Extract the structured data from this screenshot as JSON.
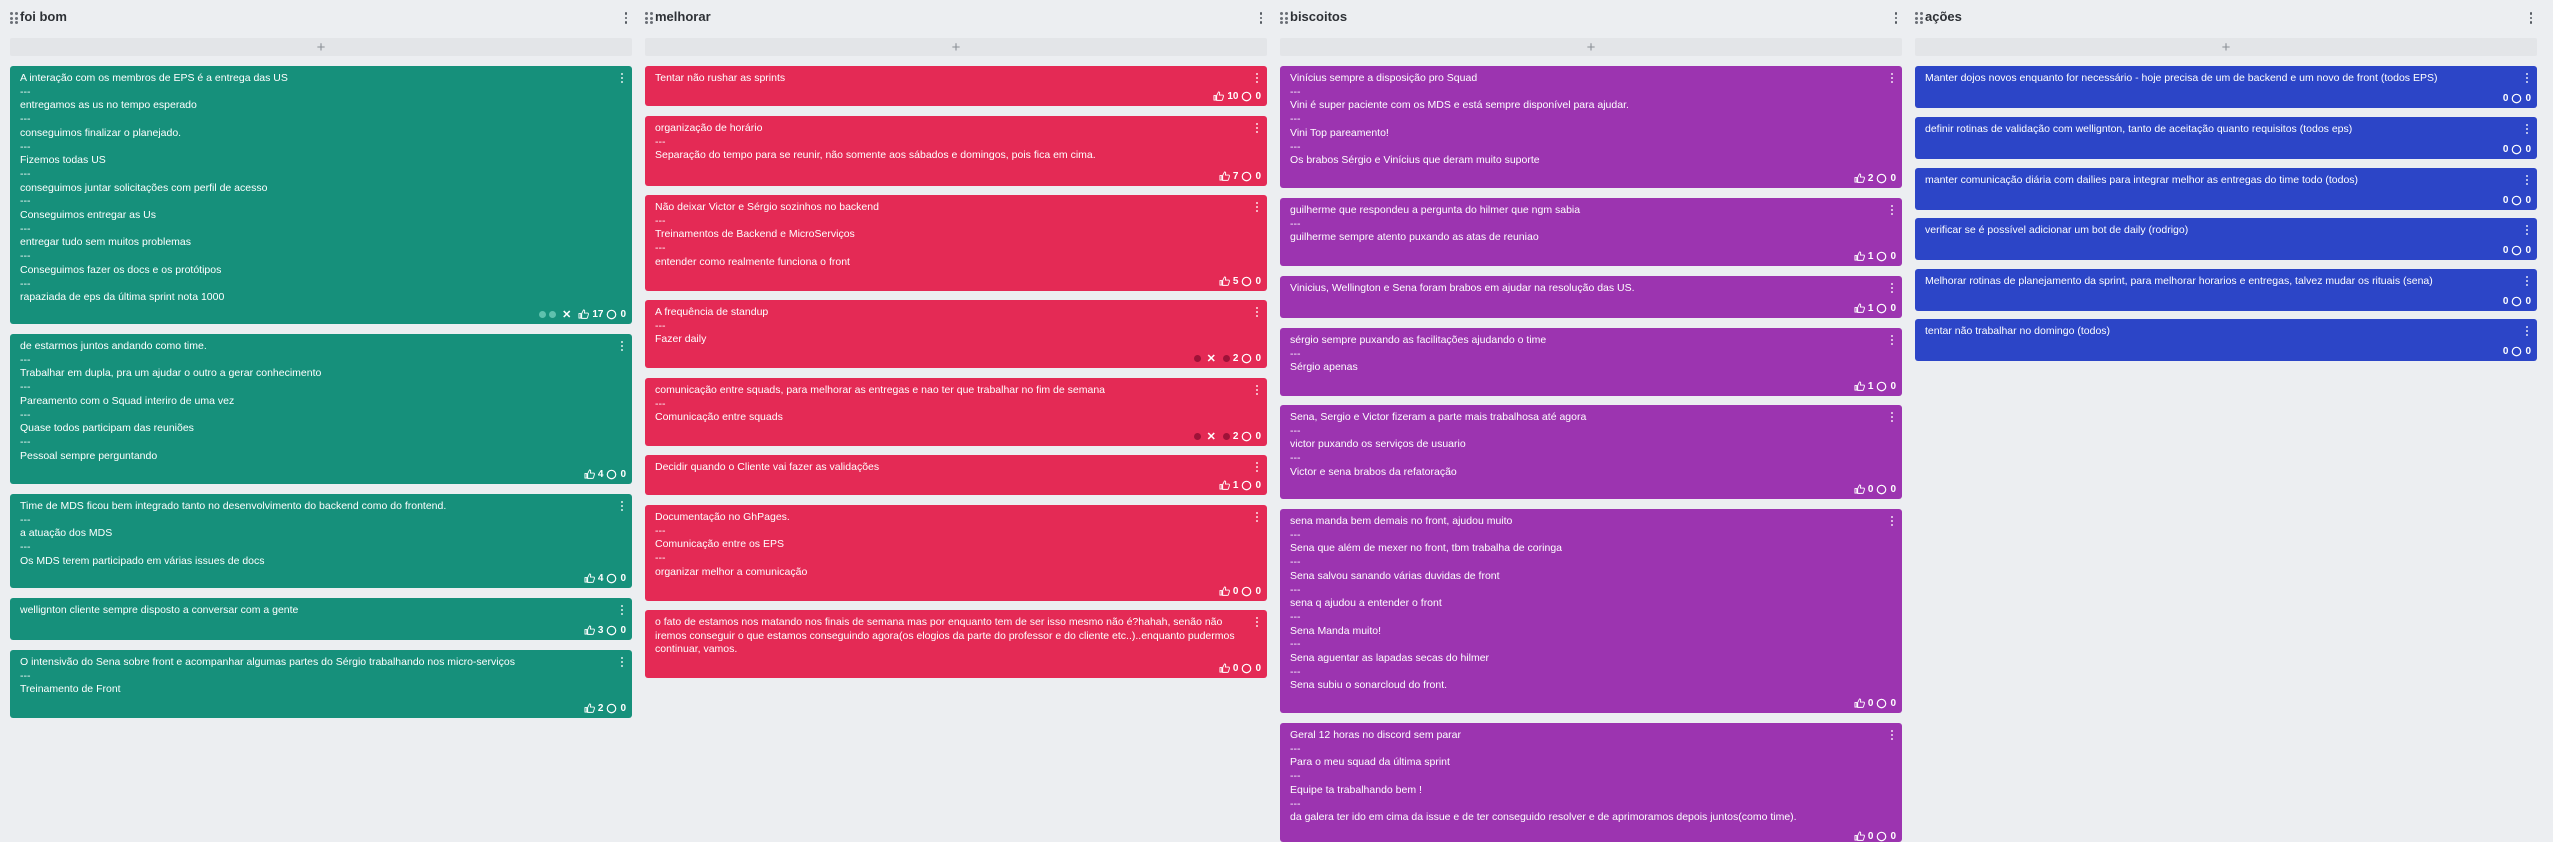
{
  "columns": [
    {
      "title": "foi bom",
      "add_label": "+",
      "cards": [
        {
          "text": "A interação com os membros de EPS é a entrega das US\n---\nentregamos as us no tempo esperado\n---\nconseguimos finalizar o planejado.\n---\nFizemos todas US\n---\nconseguimos juntar solicitações com perfil de acesso\n---\nConseguimos entregar as Us\n---\nentregar tudo sem muitos problemas\n---\nConseguimos fazer os docs e os protótipos\n---\nrapaziada de eps da última sprint nota 1000",
          "likes": "17",
          "comments": "0",
          "dots": true
        },
        {
          "text": "de estarmos juntos andando como time.\n---\nTrabalhar em dupla, pra um ajudar o outro a gerar conhecimento\n---\nPareamento com o Squad interiro de uma vez\n---\nQuase todos participam das reuniões\n---\nPessoal sempre perguntando",
          "likes": "4",
          "comments": "0"
        },
        {
          "text": "Time de MDS ficou bem integrado tanto no desenvolvimento do backend como do frontend.\n---\na atuação dos MDS\n---\nOs MDS terem participado em várias issues de docs",
          "likes": "4",
          "comments": "0"
        },
        {
          "text": "wellignton cliente sempre disposto a conversar com a gente",
          "likes": "3",
          "comments": "0"
        },
        {
          "text": "O intensivão do Sena sobre front e acompanhar algumas partes do Sérgio trabalhando nos micro-serviços\n---\nTreinamento de Front",
          "likes": "2",
          "comments": "0"
        }
      ]
    },
    {
      "title": "melhorar",
      "add_label": "+",
      "cards": [
        {
          "text": "Tentar não rushar as sprints",
          "likes": "10",
          "comments": "0"
        },
        {
          "text": "organização de horário\n---\nSeparação do tempo para se reunir, não somente aos sábados e domingos, pois fica em cima.",
          "likes": "7",
          "comments": "0"
        },
        {
          "text": "Não deixar Victor e Sérgio sozinhos no backend\n---\nTreinamentos de Backend e MicroServiços\n---\nentender como realmente funciona o front",
          "likes": "5",
          "comments": "0"
        },
        {
          "text": "A frequência de standup\n---\nFazer daily",
          "likes": "2",
          "comments": "0",
          "reacted": true
        },
        {
          "text": "comunicação entre squads, para melhorar as entregas e nao ter que trabalhar no fim de semana\n---\nComunicação entre squads",
          "likes": "2",
          "comments": "0",
          "reacted": true
        },
        {
          "text": "Decidir quando o Cliente vai fazer as validações",
          "likes": "1",
          "comments": "0"
        },
        {
          "text": "Documentação no GhPages.\n---\nComunicação entre os EPS\n---\norganizar melhor a comunicação",
          "likes": "0",
          "comments": "0"
        },
        {
          "text": "o fato de estamos nos matando nos finais de semana mas por enquanto tem de ser isso mesmo não é?hahah, senão não iremos conseguir o que estamos conseguindo agora(os elogios da parte do professor e do cliente etc..)..enquanto pudermos continuar, vamos.",
          "likes": "0",
          "comments": "0"
        }
      ]
    },
    {
      "title": "biscoitos",
      "add_label": "+",
      "cards": [
        {
          "text": "Vinícius sempre a disposição pro Squad\n---\nVini é super paciente com os MDS e está sempre disponível para ajudar.\n---\nVini Top pareamento!\n---\nOs brabos Sérgio e Vinícius que deram muito suporte",
          "likes": "2",
          "comments": "0"
        },
        {
          "text": "guilherme que respondeu a pergunta do hilmer que ngm sabia\n---\nguilherme sempre atento puxando as atas de reuniao",
          "likes": "1",
          "comments": "0"
        },
        {
          "text": "Vinicius, Wellington e Sena foram brabos em ajudar na resolução das US.",
          "likes": "1",
          "comments": "0"
        },
        {
          "text": "sérgio sempre puxando as facilitações ajudando o time\n---\nSérgio apenas",
          "likes": "1",
          "comments": "0"
        },
        {
          "text": "Sena, Sergio e Victor fizeram a parte mais trabalhosa até agora\n---\nvictor puxando os serviços de usuario\n---\nVictor e sena brabos da refatoração",
          "likes": "0",
          "comments": "0"
        },
        {
          "text": "sena manda bem demais no front, ajudou muito\n---\nSena que além de mexer no front, tbm trabalha de coringa\n---\nSena salvou sanando várias duvidas de front\n---\nsena q ajudou a entender o front\n---\nSena Manda muito!\n---\nSena aguentar as lapadas secas do hilmer\n---\nSena subiu o sonarcloud do front.",
          "likes": "0",
          "comments": "0"
        },
        {
          "text": "Geral 12 horas no discord sem parar\n---\nPara o meu squad da última sprint\n---\nEquipe ta trabalhando bem !\n---\nda galera ter ido em cima da issue e de ter conseguido resolver e de aprimoramos depois juntos(como time).",
          "likes": "0",
          "comments": "0"
        }
      ]
    },
    {
      "title": "ações",
      "add_label": "+",
      "cards": [
        {
          "text": "Manter dojos novos enquanto for necessário - hoje precisa de um de backend e um novo de front (todos EPS)",
          "likes": "0",
          "comments": "0"
        },
        {
          "text": "definir rotinas de validação com wellignton, tanto de aceitação quanto requisitos (todos eps)",
          "likes": "0",
          "comments": "0"
        },
        {
          "text": "manter comunicação diária com dailies para integrar melhor as entregas do time todo (todos)",
          "likes": "0",
          "comments": "0"
        },
        {
          "text": "verificar se é possível adicionar um bot de daily (rodrigo)",
          "likes": "0",
          "comments": "0"
        },
        {
          "text": "Melhorar rotinas de planejamento da sprint, para melhorar horarios e entregas, talvez mudar os rituais (sena)",
          "likes": "0",
          "comments": "0"
        },
        {
          "text": "tentar não trabalhar no domingo (todos)",
          "likes": "0",
          "comments": "0"
        }
      ]
    }
  ],
  "colors": {
    "foi_bom": "#16907b",
    "melhorar": "#e42a55",
    "biscoitos": "#9c34b0",
    "acoes": "#2c45c7",
    "background": "#eceef1"
  }
}
